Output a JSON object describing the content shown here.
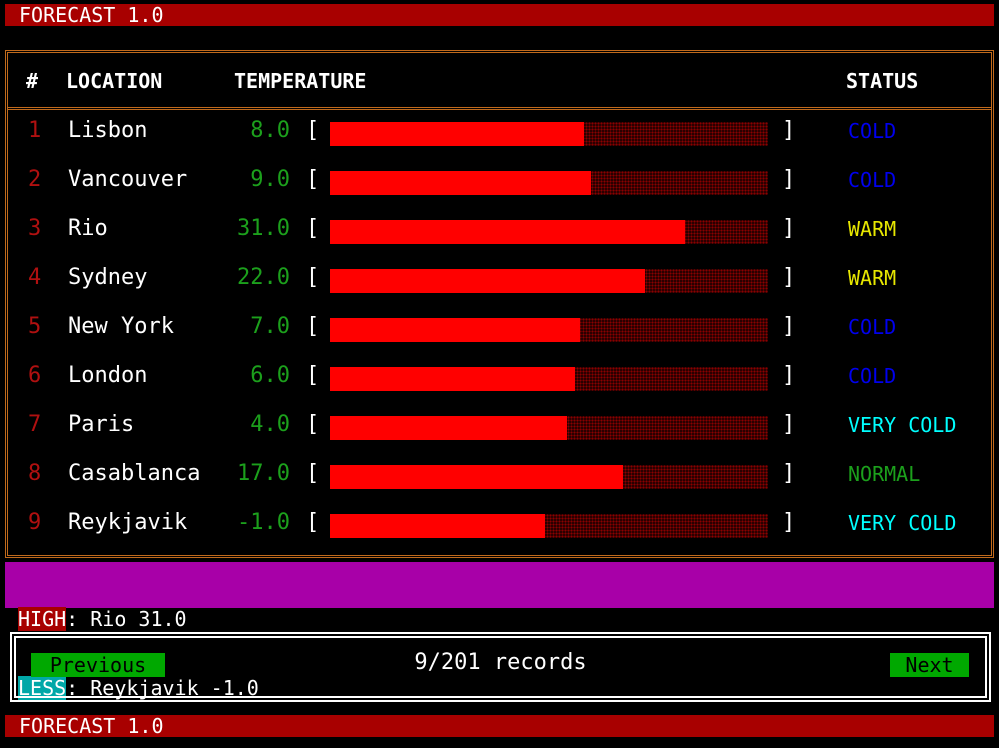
{
  "app": {
    "title": "FORECAST 1.0"
  },
  "table": {
    "headers": {
      "num": "#",
      "location": "LOCATION",
      "temperature": "TEMPERATURE",
      "status": "STATUS"
    },
    "bracket_left": "[",
    "bracket_right": "]",
    "rows": [
      {
        "num": "1",
        "location": "Lisbon",
        "temp": "8.0",
        "bar_fraction": 0.58,
        "status": "COLD",
        "status_color": "#0000ee"
      },
      {
        "num": "2",
        "location": "Vancouver",
        "temp": "9.0",
        "bar_fraction": 0.595,
        "status": "COLD",
        "status_color": "#0000ee"
      },
      {
        "num": "3",
        "location": "Rio",
        "temp": "31.0",
        "bar_fraction": 0.81,
        "status": "WARM",
        "status_color": "#e8e800"
      },
      {
        "num": "4",
        "location": "Sydney",
        "temp": "22.0",
        "bar_fraction": 0.72,
        "status": "WARM",
        "status_color": "#e8e800"
      },
      {
        "num": "5",
        "location": "New York",
        "temp": "7.0",
        "bar_fraction": 0.57,
        "status": "COLD",
        "status_color": "#0000ee"
      },
      {
        "num": "6",
        "location": "London",
        "temp": "6.0",
        "bar_fraction": 0.56,
        "status": "COLD",
        "status_color": "#0000ee"
      },
      {
        "num": "7",
        "location": "Paris",
        "temp": "4.0",
        "bar_fraction": 0.54,
        "status": "VERY COLD",
        "status_color": "#00ffff"
      },
      {
        "num": "8",
        "location": "Casablanca",
        "temp": "17.0",
        "bar_fraction": 0.67,
        "status": "NORMAL",
        "status_color": "#1ca01c"
      },
      {
        "num": "9",
        "location": "Reykjavik",
        "temp": "-1.0",
        "bar_fraction": 0.49,
        "status": "VERY COLD",
        "status_color": "#00ffff"
      }
    ]
  },
  "summary": {
    "high_label": "HIGH",
    "high_value": ": Rio 31.0",
    "less_label": "LESS",
    "less_value": ": Reykjavik -1.0"
  },
  "pager": {
    "previous_label": "Previous",
    "next_label": "Next",
    "records_text": "9/201 records"
  }
}
